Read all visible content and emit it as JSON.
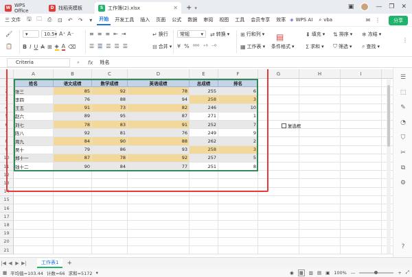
{
  "window": {
    "tabs": [
      {
        "label": "WPS Office",
        "icon_color": "#e53935"
      },
      {
        "label": "找稻壳模板",
        "icon_color": "#e53935"
      },
      {
        "label": "工作簿(2).xlsx",
        "icon_color": "#1fb36b"
      }
    ],
    "new_tab": "+"
  },
  "menu": {
    "file": "三 文件",
    "items": [
      "开始",
      "开发工具",
      "插入",
      "页面",
      "公式",
      "数据",
      "审阅",
      "视图",
      "工具",
      "会员专享",
      "效率"
    ],
    "active": "开始",
    "wps_ai": "WPS AI",
    "vba": "vba",
    "share": "分享"
  },
  "ribbon": {
    "font_size": "10.5",
    "wrap": "换行",
    "merge": "合并",
    "format": "常规",
    "convert": "转换",
    "rows_cols": "行和列",
    "worksheet": "工作表",
    "cond_format": "条件格式",
    "fill": "填充",
    "sum": "求和",
    "sort": "排序",
    "filter": "筛选",
    "freeze": "冻结",
    "find": "查找"
  },
  "formula_bar": {
    "name_box": "Criteria",
    "fx": "fx",
    "content": "姓名"
  },
  "grid": {
    "columns": [
      "A",
      "B",
      "C",
      "D",
      "E",
      "F",
      "G",
      "H",
      "I",
      "J"
    ],
    "rows": [
      "1",
      "2",
      "3",
      "4",
      "5",
      "6",
      "7",
      "8",
      "9",
      "10",
      "11",
      "12",
      "13",
      "14",
      "15",
      "16",
      "17",
      "18",
      "19",
      "20",
      "21"
    ],
    "header": [
      "姓名",
      "语文成绩",
      "数学成绩",
      "英语成绩",
      "总成绩",
      "排名"
    ],
    "data": [
      [
        "张三",
        "85",
        "92",
        "78",
        "255",
        "6"
      ],
      [
        "李四",
        "76",
        "88",
        "94",
        "258",
        "3"
      ],
      [
        "王五",
        "91",
        "73",
        "82",
        "246",
        "10"
      ],
      [
        "赵六",
        "89",
        "95",
        "87",
        "271",
        "1"
      ],
      [
        "刘七",
        "78",
        "83",
        "91",
        "252",
        "7"
      ],
      [
        "陈八",
        "92",
        "81",
        "76",
        "249",
        "9"
      ],
      [
        "周九",
        "84",
        "90",
        "88",
        "262",
        "2"
      ],
      [
        "吴十",
        "79",
        "86",
        "93",
        "258",
        "3"
      ],
      [
        "郑十一",
        "87",
        "78",
        "92",
        "257",
        "5"
      ],
      [
        "钱十二",
        "90",
        "84",
        "77",
        "251",
        "8"
      ]
    ],
    "checkbox_label": "复选框"
  },
  "sheet": {
    "tab": "工作表1",
    "add": "+"
  },
  "status": {
    "average": "平均值=103.44",
    "count": "计数=66",
    "sum": "求和=5172",
    "zoom": "100%"
  }
}
